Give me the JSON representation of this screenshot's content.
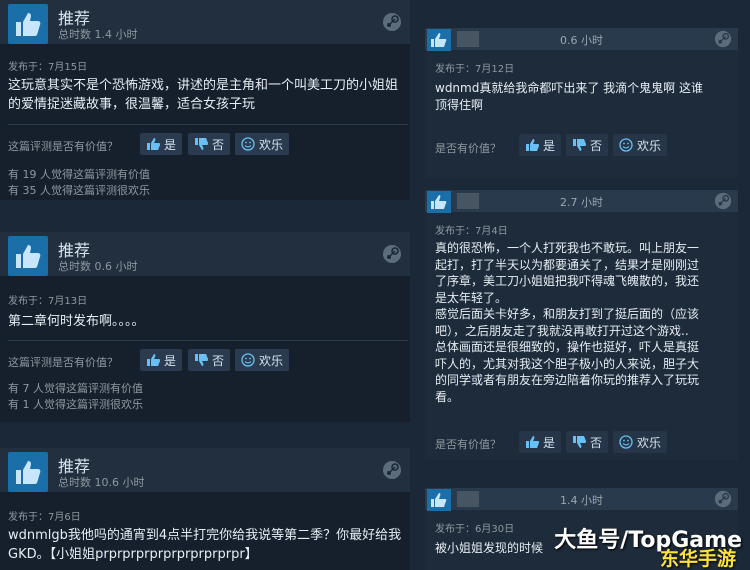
{
  "left_reviews": [
    {
      "recommend": "推荐",
      "hours": "总时数 1.4 小时",
      "posted": "发布于：7月15日",
      "text_lines": [
        "这玩意其实不是个恐怖游戏，讲述的是主角和一个叫美工刀的小姐姐",
        "的爱情捉迷藏故事，很温馨，适合女孩子玩"
      ],
      "helpful_q": "这篇评测是否有价值？",
      "yes": "是",
      "no": "否",
      "funny": "欢乐",
      "stat1": "有 19 人觉得这篇评测有价值",
      "stat2": "有 35 人觉得这篇评测很欢乐"
    },
    {
      "recommend": "推荐",
      "hours": "总时数 0.6 小时",
      "posted": "发布于：7月13日",
      "text_lines": [
        "第二章何时发布啊。。。。"
      ],
      "helpful_q": "这篇评测是否有价值？",
      "yes": "是",
      "no": "否",
      "funny": "欢乐",
      "stat1": "有 7 人觉得这篇评测有价值",
      "stat2": "有 1 人觉得这篇评测很欢乐"
    },
    {
      "recommend": "推荐",
      "hours": "总时数 10.6 小时",
      "posted": "发布于：7月6日",
      "text_lines": [
        "wdnmlgb我他吗的通宵到4点半打完你给我说等第二季？你最好给我",
        "GKD。【小姐姐prprprprprprprprprprpr】"
      ]
    }
  ],
  "right_reviews": [
    {
      "hours": "0.6 小时",
      "posted": "发布于：7月12日",
      "text_lines": [
        "wdnmd真就给我命都吓出来了 我滴个鬼鬼啊 这谁",
        "顶得住啊"
      ],
      "helpful_q": "是否有价值？",
      "yes": "是",
      "no": "否",
      "funny": "欢乐"
    },
    {
      "hours": "2.7 小时",
      "posted": "发布于：7月4日",
      "text_lines": [
        "真的很恐怖，一个人打死我也不敢玩。叫上朋友一",
        "起打，打了半天以为都要通关了，结果才是刚刚过",
        "了序章，美工刀小姐姐把我吓得魂飞魄散的，我还",
        "是太年轻了。",
        "感觉后面关卡好多，和朋友打到了挺后面的（应该",
        "吧），之后朋友走了我就没再敢打开过这个游戏..",
        "总体画面还是很细致的，操作也挺好，吓人是真挺",
        "吓人的，尤其对我这个胆子极小的人来说，胆子大",
        "的同学或者有朋友在旁边陪着你玩的推荐入了玩玩",
        "看。"
      ],
      "helpful_q": "是否有价值？",
      "yes": "是",
      "no": "否",
      "funny": "欢乐"
    },
    {
      "hours": "1.4 小时",
      "posted": "发布于：6月30日",
      "text_lines": [
        "被小姐姐发现的时候"
      ]
    }
  ],
  "watermark": "大鱼号/TopGame",
  "watermark2": "东华手游"
}
